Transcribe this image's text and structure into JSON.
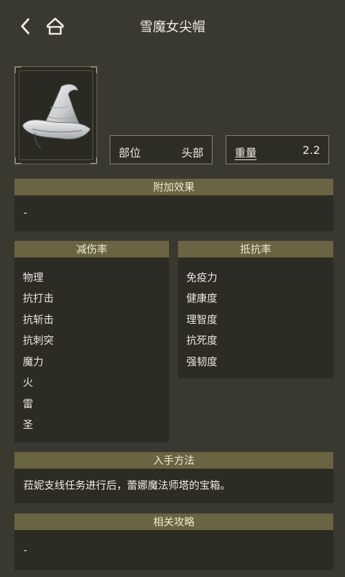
{
  "header": {
    "title": "雪魔女尖帽"
  },
  "stats": {
    "part_label": "部位",
    "part_value": "头部",
    "weight_label": "重量",
    "weight_value": "2.2"
  },
  "effects": {
    "title": "附加效果",
    "value": "-"
  },
  "damage_negation": {
    "title": "减伤率",
    "items": [
      "物理",
      "抗打击",
      "抗斩击",
      "抗刺突",
      "魔力",
      "火",
      "雷",
      "圣"
    ]
  },
  "resistance": {
    "title": "抵抗率",
    "items": [
      "免疫力",
      "健康度",
      "理智度",
      "抗死度",
      "强韧度"
    ]
  },
  "acquisition": {
    "title": "入手方法",
    "text": "菈妮支线任务进行后，蕾娜魔法师塔的宝箱。"
  },
  "guides": {
    "title": "相关攻略",
    "value": "-"
  },
  "colors": {
    "background": "#3a3930",
    "section_header": "#6b6443",
    "panel": "#2c2b24"
  }
}
